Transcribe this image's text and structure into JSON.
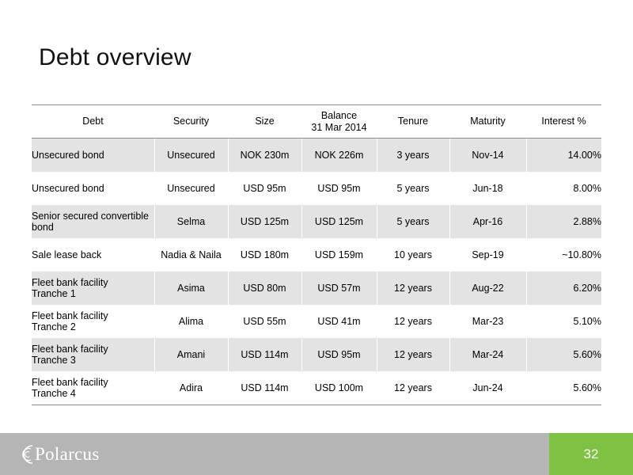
{
  "slide": {
    "title": "Debt overview",
    "page_number": "32"
  },
  "table": {
    "headers": {
      "debt": "Debt",
      "security": "Security",
      "size": "Size",
      "balance_line1": "Balance",
      "balance_line2": "31 Mar 2014",
      "tenure": "Tenure",
      "maturity": "Maturity",
      "interest": "Interest %"
    },
    "rows": [
      {
        "debt": [
          "Unsecured bond"
        ],
        "security": "Unsecured",
        "size": "NOK 230m",
        "balance": "NOK 226m",
        "tenure": "3 years",
        "maturity": "Nov-14",
        "interest": "14.00%"
      },
      {
        "debt": [
          "Unsecured bond"
        ],
        "security": "Unsecured",
        "size": "USD 95m",
        "balance": "USD 95m",
        "tenure": "5 years",
        "maturity": "Jun-18",
        "interest": "8.00%"
      },
      {
        "debt": [
          "Senior secured convertible",
          "bond"
        ],
        "security": "Selma",
        "size": "USD 125m",
        "balance": "USD 125m",
        "tenure": "5 years",
        "maturity": "Apr-16",
        "interest": "2.88%"
      },
      {
        "debt": [
          "Sale lease back"
        ],
        "security": "Nadia & Naila",
        "size": "USD 180m",
        "balance": "USD 159m",
        "tenure": "10 years",
        "maturity": "Sep-19",
        "interest": "~10.80%"
      },
      {
        "debt": [
          "Fleet bank facility",
          "Tranche 1"
        ],
        "security": "Asima",
        "size": "USD 80m",
        "balance": "USD 57m",
        "tenure": "12 years",
        "maturity": "Aug-22",
        "interest": "6.20%"
      },
      {
        "debt": [
          "Fleet bank facility",
          "Tranche 2"
        ],
        "security": "Alima",
        "size": "USD 55m",
        "balance": "USD 41m",
        "tenure": "12 years",
        "maturity": "Mar-23",
        "interest": "5.10%"
      },
      {
        "debt": [
          "Fleet bank facility",
          "Tranche 3"
        ],
        "security": "Amani",
        "size": "USD 114m",
        "balance": "USD 95m",
        "tenure": "12 years",
        "maturity": "Mar-24",
        "interest": "5.60%"
      },
      {
        "debt": [
          "Fleet bank facility",
          "Tranche 4"
        ],
        "security": "Adira",
        "size": "USD 114m",
        "balance": "USD 100m",
        "tenure": "12 years",
        "maturity": "Jun-24",
        "interest": "5.60%"
      }
    ]
  },
  "footer": {
    "logo_text": "Polarcus",
    "logo_icon": "polarcus-arc-logo-icon"
  },
  "colors": {
    "footer_bar": "#b5b5b5",
    "page_box": "#7dc242",
    "row_shade": "#e3e3e3",
    "rule": "#8c8c8c"
  }
}
